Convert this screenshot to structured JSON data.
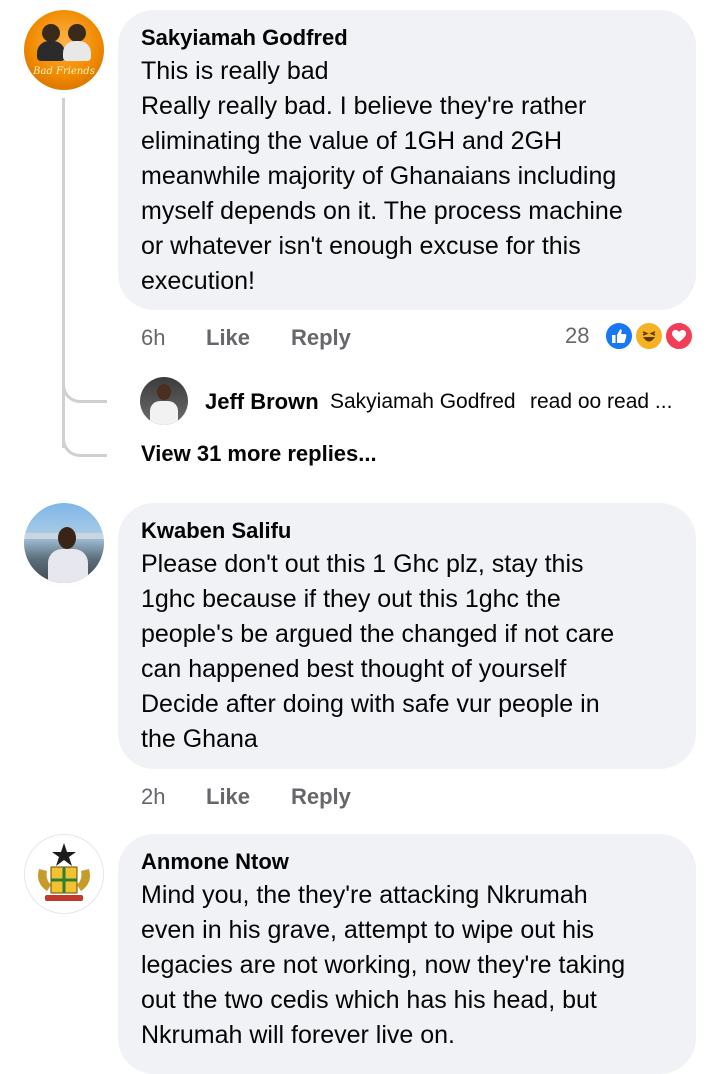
{
  "comments": [
    {
      "author": "Sakyiamah Godfred",
      "avatar_caption": "Bad Friends",
      "lines": [
        "This is really bad",
        "Really really bad. I believe they're rather",
        "eliminating the value of 1GH and 2GH",
        "meanwhile majority of Ghanaians including",
        "myself depends on it. The process machine",
        "or whatever isn't enough excuse for this",
        "execution!"
      ],
      "time": "6h",
      "like_label": "Like",
      "reply_label": "Reply",
      "reaction_count": "28",
      "reactions": [
        "like-icon",
        "haha-icon",
        "love-icon"
      ],
      "reply_preview": {
        "author": "Jeff Brown",
        "mention": "Sakyiamah Godfred",
        "text": "read oo read ..."
      },
      "view_more": "View 31 more replies..."
    },
    {
      "author": "Kwaben Salifu",
      "lines": [
        "Please don't out this 1 Ghc plz, stay this",
        "1ghc because if they out this 1ghc the",
        "people's be argued the changed if not care",
        "can happened best thought of yourself",
        "Decide after doing with safe vur people in",
        "the Ghana"
      ],
      "time": "2h",
      "like_label": "Like",
      "reply_label": "Reply"
    },
    {
      "author": "Anmone Ntow",
      "lines": [
        "Mind you, the they're attacking Nkrumah",
        "even in his grave, attempt to wipe out his",
        "legacies are not working, now they're taking",
        "out the two cedis which has his head, but",
        "Nkrumah will forever live on."
      ]
    }
  ],
  "colors": {
    "bubble": "#f0f2f5",
    "meta_text": "#65676b",
    "like_blue": "#1877f2",
    "love_red": "#f33e58",
    "haha_yellow": "#f7b125"
  }
}
